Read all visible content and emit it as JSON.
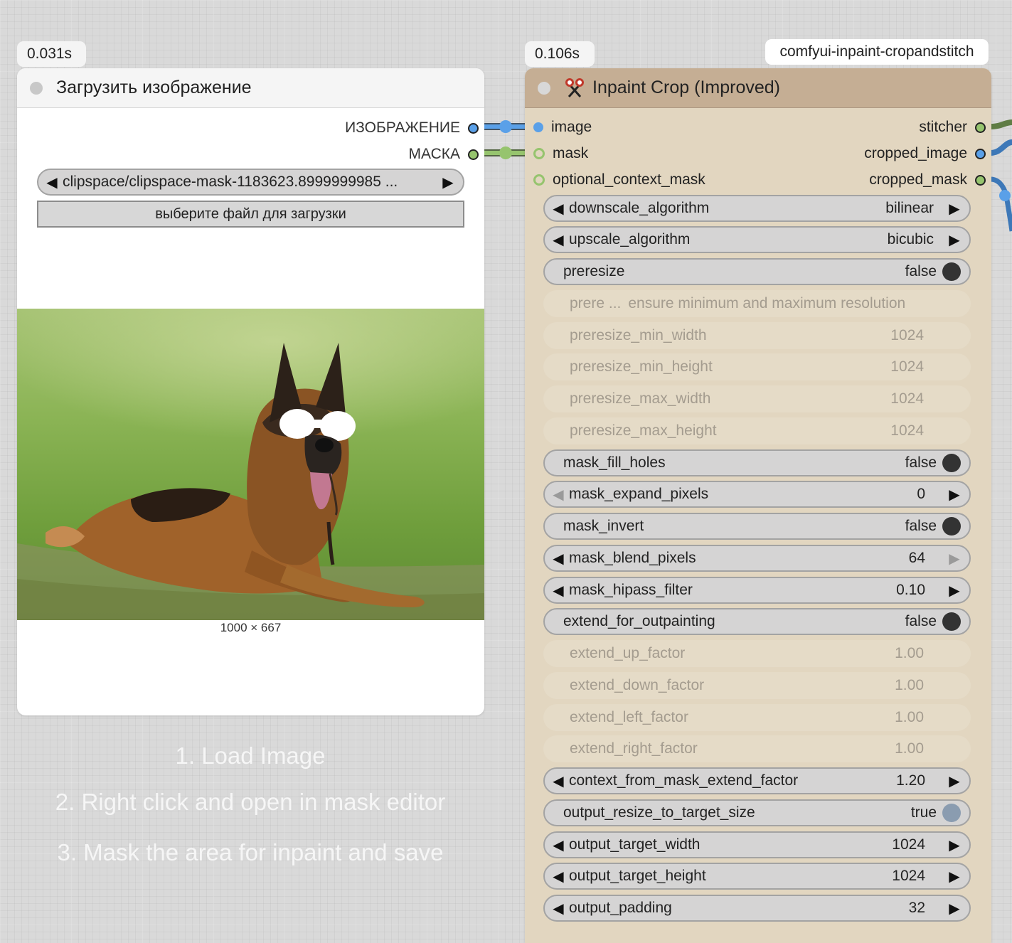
{
  "load_node": {
    "timing": "0.031s",
    "title": "Загрузить изображение",
    "outputs": [
      {
        "label": "ИЗОБРАЖЕНИЕ",
        "color": "#5aa0e8"
      },
      {
        "label": "МАСКА",
        "color": "#96c46e"
      }
    ],
    "file_combo": "clipspace/clipspace-mask-1183623.8999999985 ...",
    "upload_button": "выберите файл для загрузки",
    "image_alt": "German shepherd lying in grass with white mask shapes over eyes",
    "image_size": "1000 × 667"
  },
  "notes": [
    "1. Load Image",
    "2. Right click and open in mask editor",
    "3. Mask the area for inpaint and save"
  ],
  "crop_node": {
    "timing": "0.106s",
    "source_badge": "comfyui-inpaint-cropandstitch",
    "icon": "scissors-icon",
    "title": "Inpaint Crop (Improved)",
    "header_color": "#c5ae94",
    "body_color": "#e2d6c0",
    "inputs": [
      {
        "label": "image",
        "color": "#5aa0e8"
      },
      {
        "label": "mask",
        "color": "#96c46e"
      },
      {
        "label": "optional_context_mask",
        "color": "#96c46e"
      }
    ],
    "outputs": [
      {
        "label": "stitcher",
        "color": "#96c46e"
      },
      {
        "label": "cropped_image",
        "color": "#5aa0e8"
      },
      {
        "label": "cropped_mask",
        "color": "#96c46e"
      }
    ],
    "widgets": [
      {
        "label": "downscale_algorithm",
        "value": "bilinear",
        "kind": "combo"
      },
      {
        "label": "upscale_algorithm",
        "value": "bicubic",
        "kind": "combo"
      },
      {
        "label": "preresize",
        "value": "false",
        "kind": "toggle"
      },
      {
        "label": "prere ...",
        "value": "ensure minimum and maximum resolution",
        "kind": "disabled-text"
      },
      {
        "label": "preresize_min_width",
        "value": "1024",
        "kind": "disabled"
      },
      {
        "label": "preresize_min_height",
        "value": "1024",
        "kind": "disabled"
      },
      {
        "label": "preresize_max_width",
        "value": "1024",
        "kind": "disabled"
      },
      {
        "label": "preresize_max_height",
        "value": "1024",
        "kind": "disabled"
      },
      {
        "label": "mask_fill_holes",
        "value": "false",
        "kind": "toggle"
      },
      {
        "label": "mask_expand_pixels",
        "value": "0",
        "kind": "number-min"
      },
      {
        "label": "mask_invert",
        "value": "false",
        "kind": "toggle"
      },
      {
        "label": "mask_blend_pixels",
        "value": "64",
        "kind": "number-max"
      },
      {
        "label": "mask_hipass_filter",
        "value": "0.10",
        "kind": "number"
      },
      {
        "label": "extend_for_outpainting",
        "value": "false",
        "kind": "toggle"
      },
      {
        "label": "extend_up_factor",
        "value": "1.00",
        "kind": "disabled"
      },
      {
        "label": "extend_down_factor",
        "value": "1.00",
        "kind": "disabled"
      },
      {
        "label": "extend_left_factor",
        "value": "1.00",
        "kind": "disabled"
      },
      {
        "label": "extend_right_factor",
        "value": "1.00",
        "kind": "disabled"
      },
      {
        "label": "context_from_mask_extend_factor",
        "value": "1.20",
        "kind": "number"
      },
      {
        "label": "output_resize_to_target_size",
        "value": "true",
        "kind": "toggle-on"
      },
      {
        "label": "output_target_width",
        "value": "1024",
        "kind": "number"
      },
      {
        "label": "output_target_height",
        "value": "1024",
        "kind": "number"
      },
      {
        "label": "output_padding",
        "value": "32",
        "kind": "number"
      }
    ]
  }
}
